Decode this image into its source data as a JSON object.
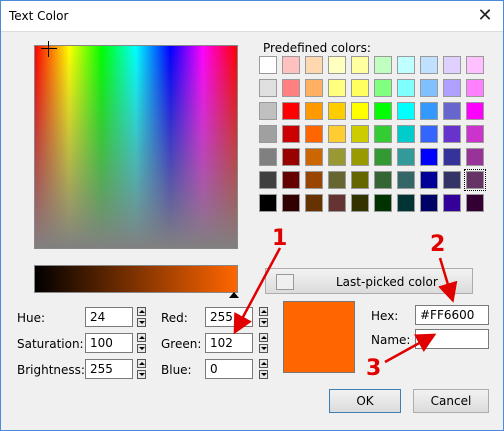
{
  "window": {
    "title": "Text Color",
    "close_glyph": "✕"
  },
  "predefined_label": "Predefined colors:",
  "swatches": [
    [
      "#ffffff",
      "#ffc0c0",
      "#ffd8b0",
      "#ffffc0",
      "#ffffa0",
      "#c0ffc0",
      "#c0ffff",
      "#c0e0ff",
      "#e0d0ff",
      "#ffc0ff"
    ],
    [
      "#e0e0e0",
      "#ff8080",
      "#ffb060",
      "#ffff80",
      "#ffff60",
      "#80ff80",
      "#80ffff",
      "#80c0ff",
      "#b0a0ff",
      "#ff80ff"
    ],
    [
      "#c0c0c0",
      "#ff0000",
      "#ff9900",
      "#ffcc00",
      "#ffff00",
      "#00ff00",
      "#00ffff",
      "#3399ff",
      "#6666cc",
      "#ff00ff"
    ],
    [
      "#a0a0a0",
      "#cc0000",
      "#ff6600",
      "#ffcc33",
      "#cccc00",
      "#33cc33",
      "#00cccc",
      "#3366ff",
      "#6633cc",
      "#cc33cc"
    ],
    [
      "#808080",
      "#990000",
      "#cc6600",
      "#999933",
      "#999900",
      "#339933",
      "#339999",
      "#0000ff",
      "#333399",
      "#993399"
    ],
    [
      "#404040",
      "#660000",
      "#994400",
      "#666633",
      "#666600",
      "#336633",
      "#336666",
      "#000099",
      "#333366",
      "#663366"
    ],
    [
      "#000000",
      "#330000",
      "#663300",
      "#663333",
      "#333300",
      "#003300",
      "#003333",
      "#000066",
      "#330099",
      "#330033"
    ]
  ],
  "selected_swatch": {
    "row": 5,
    "col": 9
  },
  "last_picked_label": "Last-picked color",
  "fields": {
    "hue": {
      "label": "Hue:",
      "value": "24"
    },
    "saturation": {
      "label": "Saturation:",
      "value": "100"
    },
    "brightness": {
      "label": "Brightness:",
      "value": "255"
    },
    "red": {
      "label": "Red:",
      "value": "255"
    },
    "green": {
      "label": "Green:",
      "value": "102"
    },
    "blue": {
      "label": "Blue:",
      "value": "0"
    },
    "hex": {
      "label": "Hex:",
      "value": "#FF6600"
    },
    "name": {
      "label": "Name:",
      "value": ""
    }
  },
  "preview_color": "#ff6600",
  "buttons": {
    "ok": "OK",
    "cancel": "Cancel"
  },
  "annotations": {
    "one": "1",
    "two": "2",
    "three": "3",
    "color": "#e00000"
  }
}
